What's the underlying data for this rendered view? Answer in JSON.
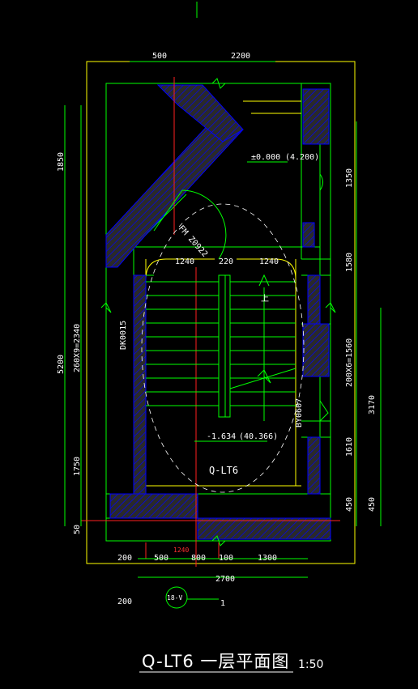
{
  "drawing": {
    "title": "Q-LT6 一层平面图",
    "scale": "1:50",
    "stair_label": "Q-LT6",
    "axis_tag": "18-V",
    "section_mark": "1"
  },
  "dims_top": [
    "500",
    "2200"
  ],
  "dims_bottom_1": [
    "200",
    "500",
    "800",
    "100",
    "1300"
  ],
  "dims_bottom_2": [
    "2700"
  ],
  "dims_bottom_3": [
    "200"
  ],
  "dims_left_outer": [
    "1850",
    "5200",
    "1750",
    "50"
  ],
  "dims_left_inner": [
    "260X9=2340"
  ],
  "dims_right_inner": [
    "1350",
    "1580",
    "200X6=1560",
    "1610",
    "450"
  ],
  "dims_right_outer": [
    "3170",
    "450"
  ],
  "dims_interior": [
    "1240",
    "220",
    "1240"
  ],
  "red_dims": [
    "1240"
  ],
  "levels": {
    "upper_level": "±0.000",
    "upper_level_note": "(4.200)",
    "lower_level": "-1.634",
    "lower_level_note": "(40.366)"
  },
  "door_labels": [
    "FM Z0922",
    "DK0015",
    "BY0607"
  ],
  "direction_label": "上",
  "colors": {
    "background": "#000000",
    "wall": "#00ff00",
    "hatch": "#0000ff",
    "hatch_fill": "#333333",
    "finish": "#ffff00",
    "dimension": "#00ff00",
    "text": "#ffffff",
    "axis": "#ff0000",
    "frame": "#ffff00"
  }
}
